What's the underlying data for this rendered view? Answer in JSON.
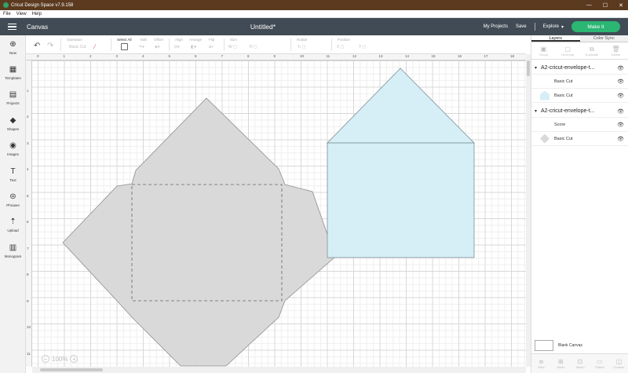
{
  "window": {
    "title": "Cricut Design Space  v7.9.158",
    "controls": [
      "—",
      "☐",
      "✕"
    ]
  },
  "menubar": [
    "File",
    "View",
    "Help"
  ],
  "header": {
    "section": "Canvas",
    "doc_title": "Untitled*",
    "my_projects": "My Projects",
    "save": "Save",
    "explore": "Explore",
    "explore_caret": "▾",
    "make_it": "Make It"
  },
  "toolbar": {
    "operation_label": "Operation",
    "operation_value": "Basic Cut",
    "select_all": "Select All",
    "edit": "Edit",
    "offset": "Offset",
    "align": "Align",
    "arrange": "Arrange",
    "flip": "Flip",
    "size": "Size",
    "rotate": "Rotate",
    "position": "Position"
  },
  "left_nav": [
    {
      "icon": "⊕",
      "label": "New"
    },
    {
      "icon": "▦",
      "label": "Templates"
    },
    {
      "icon": "▤",
      "label": "Projects"
    },
    {
      "icon": "◆",
      "label": "Shapes"
    },
    {
      "icon": "◉",
      "label": "Images"
    },
    {
      "icon": "T",
      "label": "Text"
    },
    {
      "icon": "⊜",
      "label": "Phrases"
    },
    {
      "icon": "⇡",
      "label": "Upload"
    },
    {
      "icon": "▥",
      "label": "Monogram"
    }
  ],
  "ruler": {
    "top": [
      "0",
      "1",
      "2",
      "3",
      "4",
      "5",
      "6",
      "7",
      "8",
      "9",
      "10",
      "11",
      "12",
      "13",
      "14",
      "15",
      "16",
      "17",
      "18"
    ],
    "left": [
      "1",
      "2",
      "3",
      "4",
      "5",
      "6",
      "7",
      "8",
      "9",
      "10",
      "11"
    ]
  },
  "zoom": {
    "minus": "−",
    "value": "100%",
    "plus": "+"
  },
  "right_panel": {
    "tabs": [
      "Layers",
      "Color Sync"
    ],
    "top_tools": [
      {
        "icon": "▣",
        "label": "Group"
      },
      {
        "icon": "▢",
        "label": "UnGroup"
      },
      {
        "icon": "⧉",
        "label": "Duplicate"
      },
      {
        "icon": "🗑",
        "label": "Delete"
      }
    ],
    "groups": [
      {
        "name": "A2-cricut-envelope-t...",
        "items": [
          {
            "name": "Basic Cut",
            "swatch": "none"
          },
          {
            "name": "Basic Cut",
            "swatch": "#d6eef5"
          }
        ]
      },
      {
        "name": "A2-cricut-envelope-t...",
        "items": [
          {
            "name": "Score",
            "swatch": "none"
          },
          {
            "name": "Basic Cut",
            "swatch": "#d9d9d9"
          }
        ]
      }
    ],
    "blank_canvas": "Blank Canvas",
    "bottom_tools": [
      {
        "icon": "⧈",
        "label": "Slice"
      },
      {
        "icon": "⊞",
        "label": "Weld"
      },
      {
        "icon": "⊡",
        "label": "Attach"
      },
      {
        "icon": "▭",
        "label": "Flatten"
      },
      {
        "icon": "◫",
        "label": "Contour"
      }
    ]
  },
  "colors": {
    "titlebar": "#5b3a1f",
    "header": "#414b55",
    "make_it": "#2bb673",
    "envelope_fill": "#d9d9d9",
    "card_fill": "#d6eef5"
  }
}
